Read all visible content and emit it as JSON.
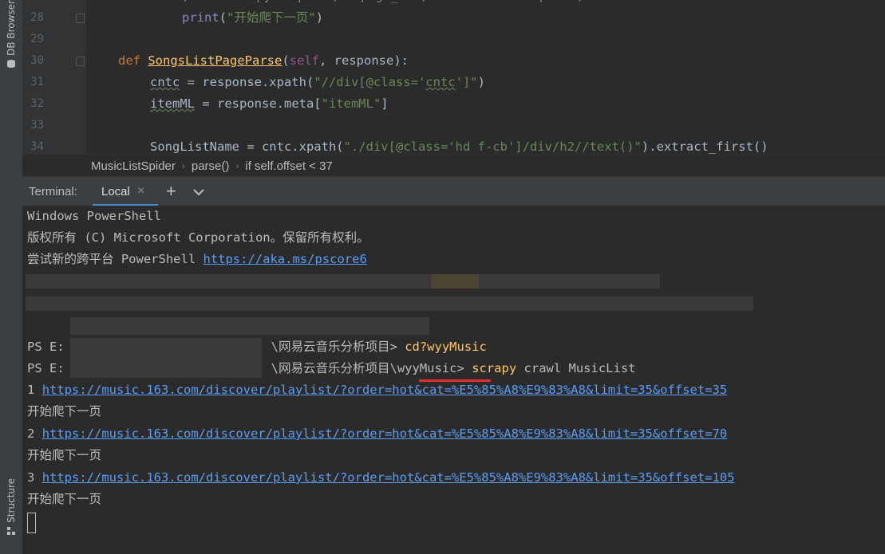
{
  "sidebar": {
    "top_tab": "DB Browser",
    "bottom_tab": "Structure"
  },
  "editor": {
    "lines": [
      {
        "num": "28",
        "code": "print(\"开始爬下一页\")"
      },
      {
        "num": "29",
        "code": ""
      },
      {
        "num": "30",
        "code": "def SongsListPageParse(self, response):"
      },
      {
        "num": "31",
        "code": "cntc = response.xpath(\"//div[@class='cntc']\")"
      },
      {
        "num": "32",
        "code": "itemML = response.meta[\"itemML\"]"
      },
      {
        "num": "33",
        "code": ""
      },
      {
        "num": "34",
        "code": "SongListName = cntc.xpath(\"./div[@class='hd f-cb']/div/h2//text()\").extract_first()"
      }
    ],
    "partial_top": ",item scrapy.Request(newpage_url, callback self.parse)"
  },
  "breadcrumb": {
    "items": [
      "MusicListSpider",
      "parse()",
      "if self.offset < 37"
    ]
  },
  "terminal_tabs": {
    "title": "Terminal:",
    "active_tab": "Local",
    "close_icon": "×",
    "add_icon": "+"
  },
  "terminal": {
    "l1": "Windows PowerShell",
    "l2": "版权所有 (C) Microsoft Corporation。保留所有权利。",
    "l3_prefix": "尝试新的跨平台 PowerShell ",
    "l3_link": "https://aka.ms/pscore6",
    "ps1_prefix": "PS E:",
    "ps1_path": "\\网易云音乐分析项目>",
    "ps1_cmd": "cd?wyyMusic",
    "ps2_prefix": "PS E:",
    "ps2_path": "\\网易云音乐分析项目",
    "ps2_dir": "\\wyyMusic>",
    "ps2_cmd": "scrapy",
    "ps2_args": "crawl MusicList",
    "out": [
      {
        "num": "1",
        "url": "https://music.163.com/discover/playlist/?order=hot&cat=%E5%85%A8%E9%83%A8&limit=35&offset=35",
        "msg": "开始爬下一页"
      },
      {
        "num": "2",
        "url": "https://music.163.com/discover/playlist/?order=hot&cat=%E5%85%A8%E9%83%A8&limit=35&offset=70",
        "msg": "开始爬下一页"
      },
      {
        "num": "3",
        "url": "https://music.163.com/discover/playlist/?order=hot&cat=%E5%85%A8%E9%83%A8&limit=35&offset=105",
        "msg": "开始爬下一页"
      }
    ]
  }
}
